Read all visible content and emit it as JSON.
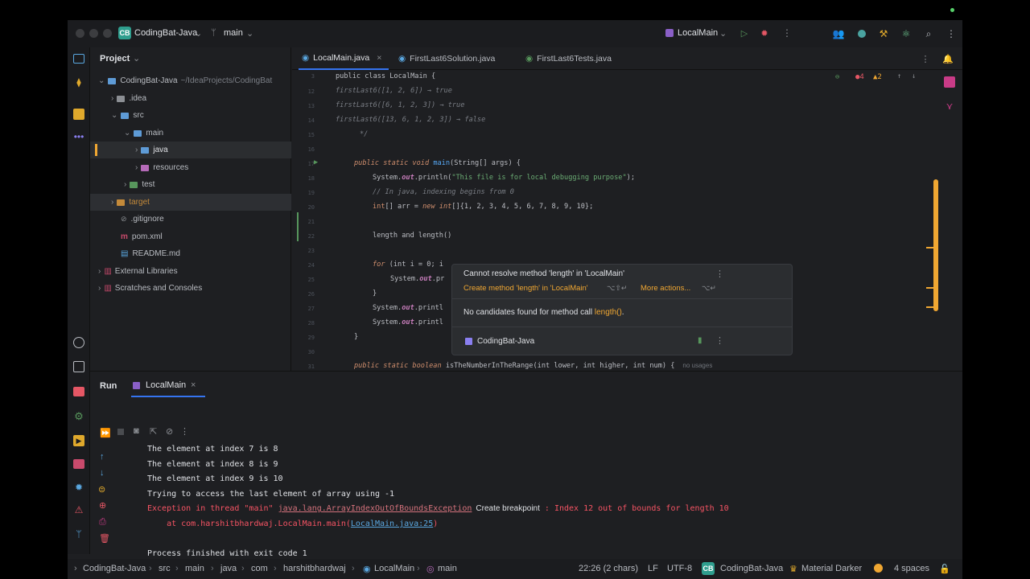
{
  "titlebar": {
    "project_badge": "CB",
    "project_name": "CodingBat-Java",
    "branch": "main",
    "run_config": "LocalMain"
  },
  "project_panel": {
    "title": "Project",
    "tree": [
      {
        "label": "CodingBat-Java",
        "suffix": "~/IdeaProjects/CodingBat"
      },
      {
        "label": ".idea"
      },
      {
        "label": "src"
      },
      {
        "label": "main"
      },
      {
        "label": "java"
      },
      {
        "label": "resources"
      },
      {
        "label": "test"
      },
      {
        "label": "target"
      },
      {
        "label": ".gitignore"
      },
      {
        "label": "pom.xml"
      },
      {
        "label": "README.md"
      },
      {
        "label": "External Libraries"
      },
      {
        "label": "Scratches and Consoles"
      }
    ]
  },
  "editor": {
    "tabs": [
      "LocalMain.java",
      "FirstLast6Solution.java",
      "FirstLast6Tests.java"
    ],
    "inspection": {
      "errors": "4",
      "warnings": "2"
    },
    "sticky_line": "public class LocalMain {",
    "line_numbers": [
      "3",
      "12",
      "13",
      "14",
      "15",
      "16",
      "17",
      "18",
      "19",
      "20",
      "21",
      "22",
      "23",
      "24",
      "25",
      "26",
      "27",
      "28",
      "29",
      "30",
      "31"
    ],
    "code": {
      "l12": "firstLast6([1, 2, 6]) → true",
      "l13": "firstLast6([6, 1, 2, 3]) → true",
      "l14": "firstLast6([13, 6, 1, 2, 3]) → false",
      "l15": "*/",
      "l17a": "public static void ",
      "l17b": "main",
      "l17c": "(String[] args) {",
      "l18a": "System.",
      "l18b": "out",
      "l18c": ".println(",
      "l18d": "\"This file is for local debugging purpose\"",
      "l18e": ");",
      "l19": "// In java, indexing begins from 0",
      "l20a": "int",
      "l20b": "[] arr = ",
      "l20c": "new int",
      "l20d": "[]{1, 2, 3, 4, 5, 6, 7, 8, 9, 10};",
      "l22": "length and length()",
      "l24a": "for",
      "l24b": " (int i = 0; i",
      "l25a": "System.",
      "l25b": "out",
      "l25c": ".pr",
      "l26": "}",
      "l27a": "System.",
      "l27b": "out",
      "l27c": ".printl",
      "l28a": "System.",
      "l28b": "out",
      "l28c": ".printl",
      "l29": "}",
      "l31a": "public static boolean ",
      "l31b": "isTheNumberInTheRange",
      "l31c": "(int lower, int higher, int num) {",
      "l31d": "no usages"
    },
    "popup": {
      "error": "Cannot resolve method 'length' in 'LocalMain'",
      "action": "Create method 'length' in 'LocalMain'",
      "action_shortcut": "⌥⇧↵",
      "more": "More actions...",
      "more_shortcut": "⌥↵",
      "candidates_prefix": "No candidates found for method call ",
      "candidates_method": "length()",
      "candidates_suffix": ".",
      "module": "CodingBat-Java"
    }
  },
  "run_panel": {
    "title": "Run",
    "tab": "LocalMain",
    "output": [
      "The element at index 7 is 8",
      "The element at index 8 is 9",
      "The element at index 9 is 10",
      "Trying to access the last element of array using -1"
    ],
    "exception_prefix": "Exception in thread \"main\" ",
    "exception_class": "java.lang.ArrayIndexOutOfBoundsException",
    "create_breakpoint": "Create breakpoint",
    "exception_message": " : Index 12 out of bounds for length 10",
    "stack_prefix": "    at com.harshitbhardwaj.LocalMain.main(",
    "stack_link": "LocalMain.java:25",
    "stack_suffix": ")",
    "exit": "Process finished with exit code 1"
  },
  "statusbar": {
    "breadcrumb": [
      "CodingBat-Java",
      "src",
      "main",
      "java",
      "com",
      "harshitbhardwaj",
      "LocalMain",
      "main"
    ],
    "position": "22:26 (2 chars)",
    "line_sep": "LF",
    "encoding": "UTF-8",
    "module_badge": "CB",
    "module": "CodingBat-Java",
    "theme": "Material Darker",
    "indent": "4 spaces"
  },
  "colors": {
    "accent": "#3574f0",
    "error": "#f75464",
    "warning": "#f0a732",
    "folder": "#5e9bd6"
  }
}
